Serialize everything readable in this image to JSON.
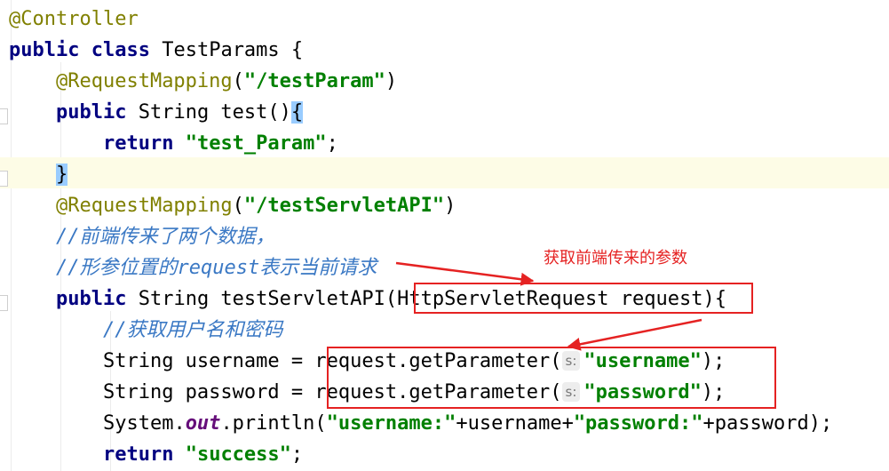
{
  "code": {
    "l1": {
      "annotation": "@Controller"
    },
    "l2": {
      "kw1": "public",
      "kw2": "class",
      "name": "TestParams {"
    },
    "l3": {
      "annotation": "@RequestMapping",
      "open": "(",
      "path": "\"/testParam\"",
      "close": ")"
    },
    "l4": {
      "kw": "public",
      "sig": " String test()",
      "brace": "{"
    },
    "l5": {
      "kw": "return",
      "value": "\"test_Param\"",
      "end": ";"
    },
    "l6": {
      "brace": "}"
    },
    "l7": {
      "annotation": "@RequestMapping",
      "open": "(",
      "path": "\"/testServletAPI\"",
      "close": ")"
    },
    "l8": {
      "slashes": "//",
      "text": "前端传来了两个数据，"
    },
    "l9": {
      "slashes": "//",
      "text1": "形参位置的",
      "word": "request",
      "text2": "表示当前请求"
    },
    "l10": {
      "kw": "public",
      "sig": " String testServletAPI(",
      "param": "HttpServletRequest request",
      "close": ")",
      "brace": "{"
    },
    "l11": {
      "slashes": "//",
      "text": "获取用户名和密码"
    },
    "l12": {
      "decl": "String username = ",
      "call": "request.getParameter(",
      "hint": "s:",
      "arg": "\"username\"",
      "end": ");"
    },
    "l13": {
      "decl": "String password = ",
      "call": "request.getParameter(",
      "hint": "s:",
      "arg": "\"password\"",
      "end": ");"
    },
    "l14": {
      "obj": "System.",
      "field": "out",
      "call": ".println(",
      "s1": "\"username:\"",
      "mid1": "+username+",
      "s2": "\"password:\"",
      "tail": "+password);"
    },
    "l15": {
      "kw": "return",
      "value": "\"success\"",
      "end": ";"
    }
  },
  "annotation_note": {
    "text": "获取前端传来的参数",
    "color": "#e52222"
  },
  "colors": {
    "keyword": "#000080",
    "string": "#008000",
    "annotation": "#808000",
    "comment": "#3a78c4",
    "highlight_line": "#fdfce6",
    "brace_match": "#99ccff",
    "callout_red": "#e52222"
  }
}
